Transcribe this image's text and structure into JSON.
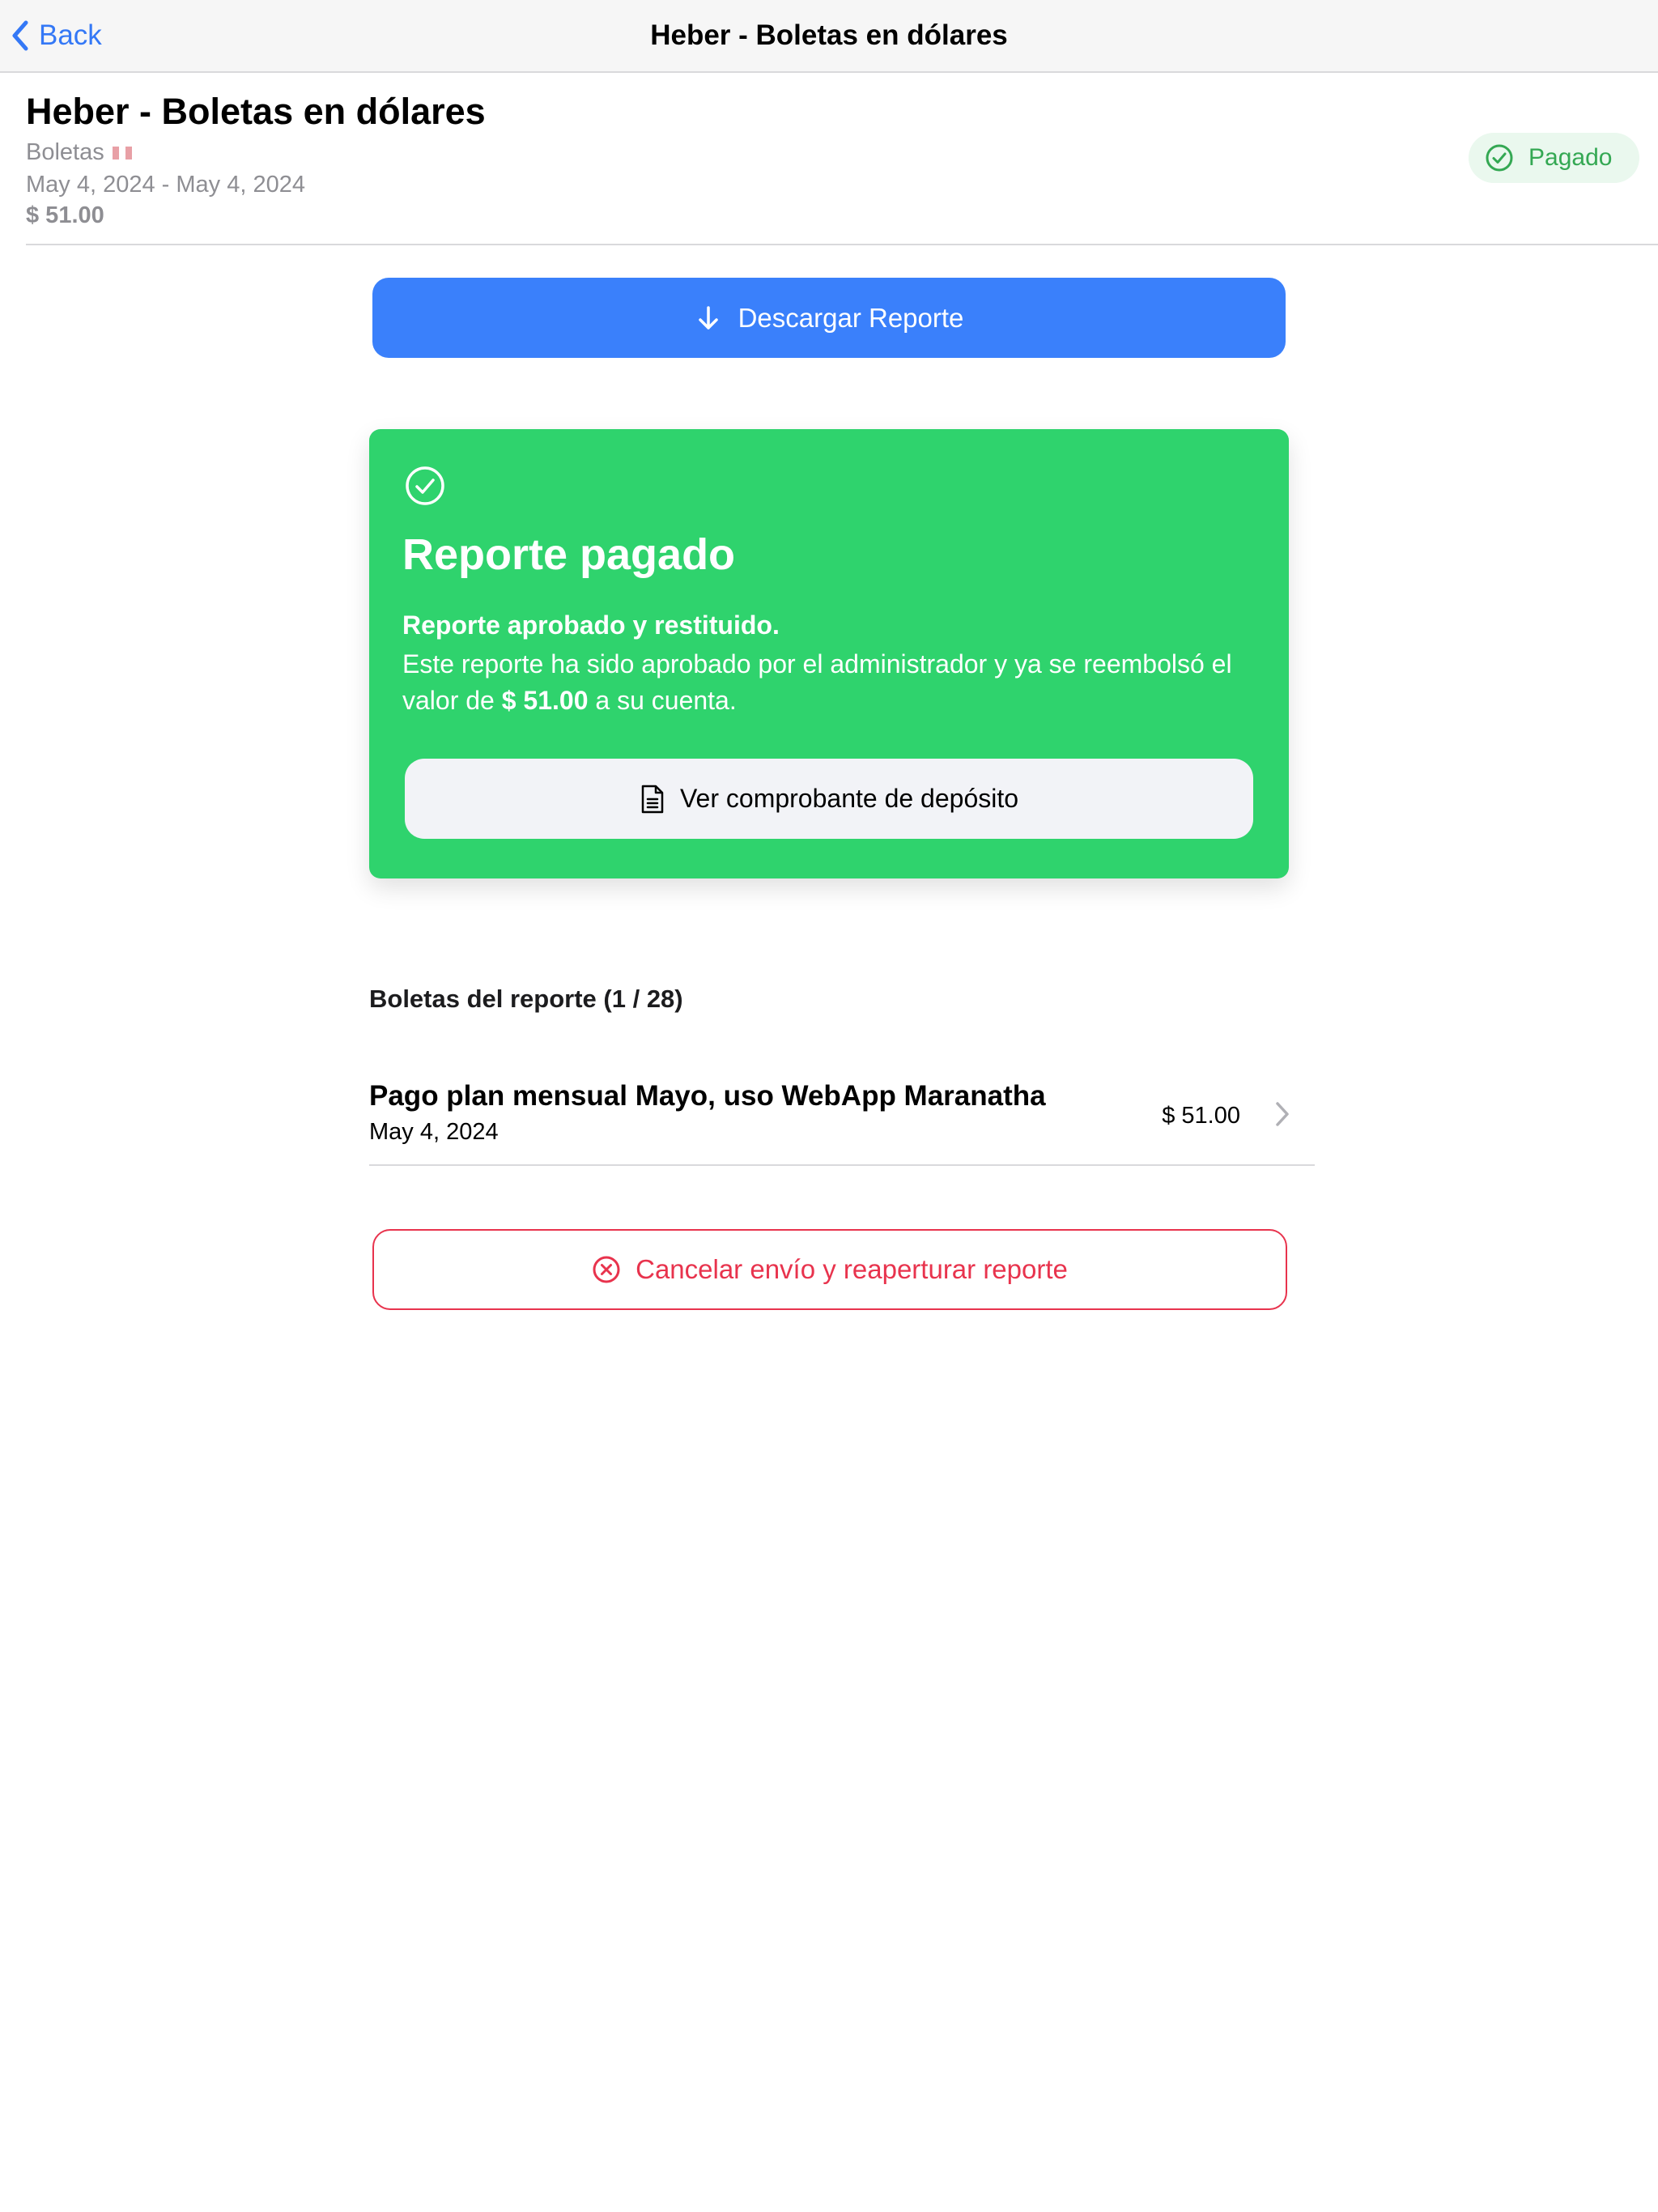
{
  "navbar": {
    "back_label": "Back",
    "title": "Heber - Boletas en dólares"
  },
  "header": {
    "title": "Heber - Boletas en dólares",
    "category": "Boletas",
    "flag_icon": "peru-flag-icon",
    "date_range": "May 4, 2024 - May 4, 2024",
    "amount": "$ 51.00",
    "status": "Pagado",
    "status_color": "#34a853"
  },
  "actions": {
    "download_label": "Descargar Reporte",
    "download_color": "#3a80fb",
    "cancel_label": "Cancelar envío y reaperturar reporte",
    "cancel_color": "#e8334d"
  },
  "paid_card": {
    "icon": "check-circle-icon",
    "title": "Reporte pagado",
    "subtitle": "Reporte aprobado y restituido.",
    "desc_before": "Este reporte ha sido aprobado por el administrador y ya se reembolsó el valor de ",
    "desc_amount": "$ 51.00",
    "desc_after": " a su cuenta.",
    "receipt_button_label": "Ver comprobante de depósito",
    "background_color": "#2fd36d"
  },
  "receipts": {
    "section_title": "Boletas del reporte (1 / 28)",
    "items": [
      {
        "title": "Pago plan mensual Mayo, uso WebApp Maranatha",
        "date": "May 4, 2024",
        "amount": "$ 51.00"
      }
    ]
  }
}
